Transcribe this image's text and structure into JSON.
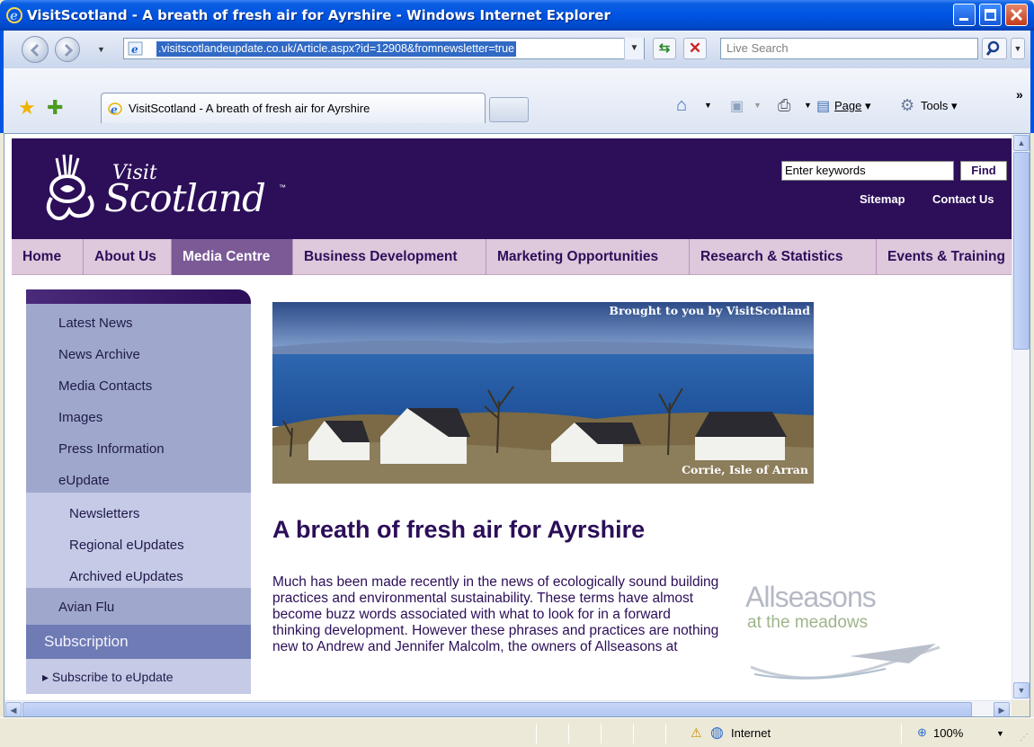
{
  "window": {
    "title": "VisitScotland - A breath of fresh air for Ayrshire - Windows Internet Explorer"
  },
  "address_bar": {
    "url": ".visitscotlandeupdate.co.uk/Article.aspx?id=12908&fromnewsletter=true"
  },
  "search": {
    "placeholder": "Live Search"
  },
  "tab": {
    "title": "VisitScotland - A breath of fresh air for Ayrshire"
  },
  "command_bar": {
    "page_label": "Page",
    "tools_label": "Tools"
  },
  "site": {
    "logo_visit": "Visit",
    "logo_scotland": "Scotland",
    "logo_tm": "™",
    "keyword_value": "Enter keywords",
    "find_label": "Find",
    "sitemap_label": "Sitemap",
    "contact_label": "Contact Us",
    "nav": [
      {
        "label": "Home"
      },
      {
        "label": "About Us"
      },
      {
        "label": "Media Centre"
      },
      {
        "label": "Business Development"
      },
      {
        "label": "Marketing Opportunities"
      },
      {
        "label": "Research & Statistics"
      },
      {
        "label": "Events & Training"
      }
    ],
    "sidebar": {
      "items": [
        "Latest News",
        "News Archive",
        "Media Contacts",
        "Images",
        "Press Information",
        "eUpdate"
      ],
      "sub_items": [
        "Newsletters",
        "Regional eUpdates",
        "Archived eUpdates"
      ],
      "after_item": "Avian Flu",
      "subscription_heading": "Subscription",
      "subscribe_link": "Subscribe to eUpdate"
    },
    "banner": {
      "credit": "Brought to you by VisitScotland",
      "caption": "Corrie, Isle of Arran"
    },
    "article": {
      "title": "A breath of fresh air for Ayrshire",
      "body": "Much has been made recently in the news of ecologically sound building practices and environmental sustainability. These terms have almost become buzz words associated with what to look for in a forward thinking development. However these phrases and practices are nothing new to Andrew and Jennifer Malcolm, the owners of Allseasons at"
    },
    "ad": {
      "name": "Allseasons",
      "sub": "at the meadows"
    }
  },
  "status_bar": {
    "zone": "Internet",
    "zoom": "100%"
  },
  "colors": {
    "brand_purple": "#2c0e59",
    "nav_bg": "#ddc8dc",
    "nav_active": "#7c5a96",
    "sidebar_bg": "#9fa8cc"
  }
}
